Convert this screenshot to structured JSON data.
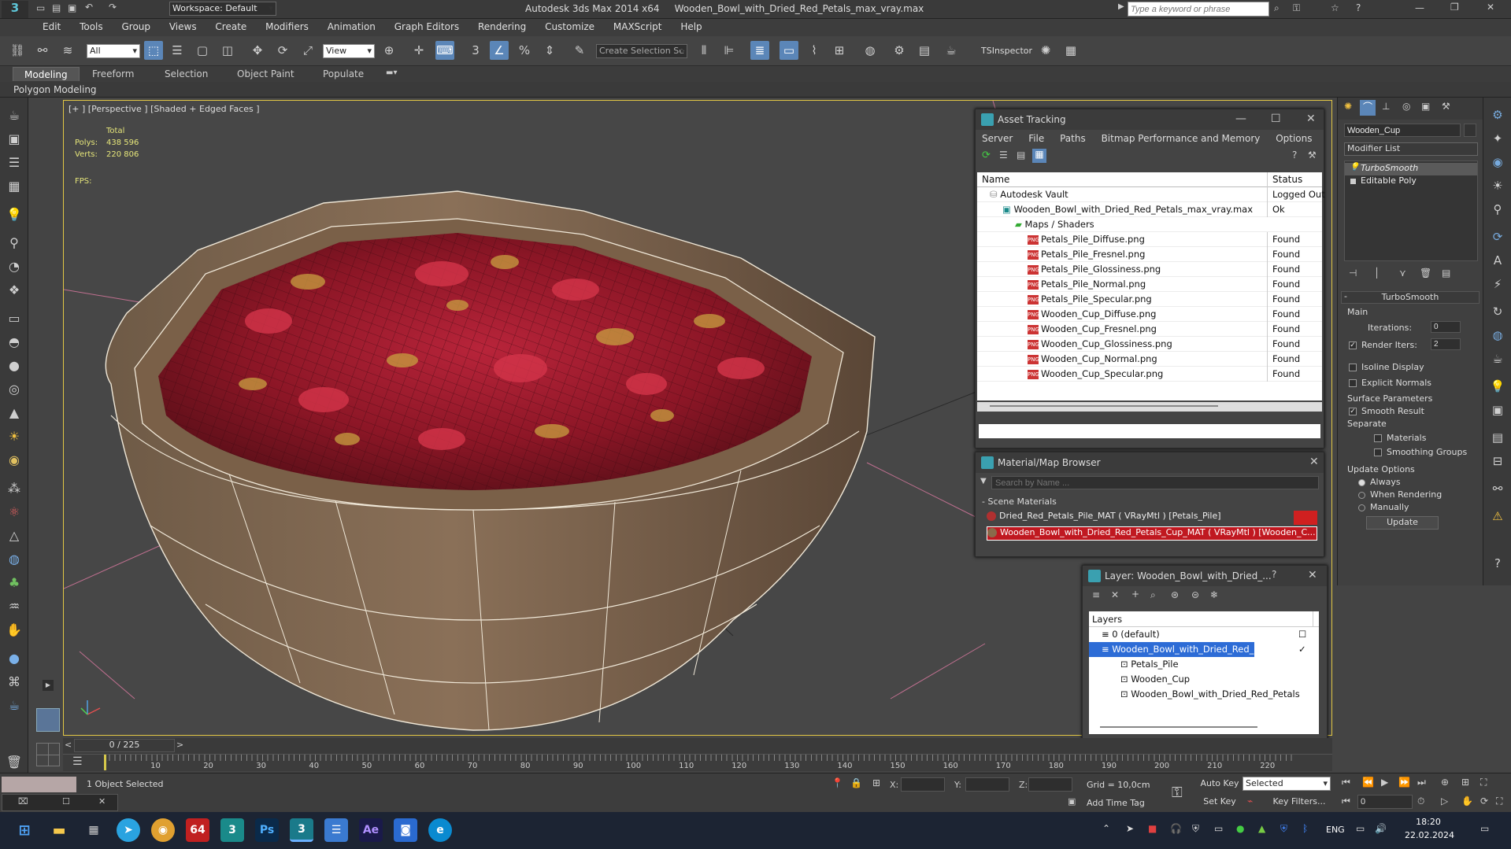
{
  "app": {
    "title": "Autodesk 3ds Max  2014 x64",
    "file": "Wooden_Bowl_with_Dried_Red_Petals_max_vray.max",
    "workspace": "Workspace: Default",
    "search_placeholder": "Type a keyword or phrase"
  },
  "menu": [
    "Edit",
    "Tools",
    "Group",
    "Views",
    "Create",
    "Modifiers",
    "Animation",
    "Graph Editors",
    "Rendering",
    "Customize",
    "MAXScript",
    "Help"
  ],
  "toolbar": {
    "filter": "All",
    "ref_coord": "View",
    "selection_set": "Create Selection Se",
    "inspector": "TSInspector"
  },
  "ribbon": {
    "tabs": [
      "Modeling",
      "Freeform",
      "Selection",
      "Object Paint",
      "Populate"
    ],
    "sub": "Polygon Modeling"
  },
  "viewport": {
    "label": "[+ ] [Perspective ] [Shaded + Edged Faces ]",
    "total_label": "Total",
    "polys_label": "Polys:",
    "polys": "438 596",
    "verts_label": "Verts:",
    "verts": "220 806",
    "fps_label": "FPS:"
  },
  "asset_tracking": {
    "title": "Asset Tracking",
    "menu": [
      "Server",
      "File",
      "Paths",
      "Bitmap Performance and Memory",
      "Options"
    ],
    "col_name": "Name",
    "col_status": "Status",
    "rows": [
      {
        "name": "Autodesk Vault",
        "status": "Logged Out",
        "indent": 1,
        "kind": "vault"
      },
      {
        "name": "Wooden_Bowl_with_Dried_Red_Petals_max_vray.max",
        "status": "Ok",
        "indent": 2,
        "kind": "max"
      },
      {
        "name": "Maps / Shaders",
        "status": "",
        "indent": 3,
        "kind": "folder"
      },
      {
        "name": "Petals_Pile_Diffuse.png",
        "status": "Found",
        "indent": 4,
        "kind": "png"
      },
      {
        "name": "Petals_Pile_Fresnel.png",
        "status": "Found",
        "indent": 4,
        "kind": "png"
      },
      {
        "name": "Petals_Pile_Glossiness.png",
        "status": "Found",
        "indent": 4,
        "kind": "png"
      },
      {
        "name": "Petals_Pile_Normal.png",
        "status": "Found",
        "indent": 4,
        "kind": "png"
      },
      {
        "name": "Petals_Pile_Specular.png",
        "status": "Found",
        "indent": 4,
        "kind": "png"
      },
      {
        "name": "Wooden_Cup_Diffuse.png",
        "status": "Found",
        "indent": 4,
        "kind": "png"
      },
      {
        "name": "Wooden_Cup_Fresnel.png",
        "status": "Found",
        "indent": 4,
        "kind": "png"
      },
      {
        "name": "Wooden_Cup_Glossiness.png",
        "status": "Found",
        "indent": 4,
        "kind": "png"
      },
      {
        "name": "Wooden_Cup_Normal.png",
        "status": "Found",
        "indent": 4,
        "kind": "png"
      },
      {
        "name": "Wooden_Cup_Specular.png",
        "status": "Found",
        "indent": 4,
        "kind": "png"
      }
    ]
  },
  "material_browser": {
    "title": "Material/Map Browser",
    "search_placeholder": "Search by Name ...",
    "section": "- Scene Materials",
    "items": [
      "Dried_Red_Petals_Pile_MAT  ( VRayMtl )  [Petals_Pile]",
      "Wooden_Bowl_with_Dried_Red_Petals_Cup_MAT  ( VRayMtl )  [Wooden_C..."
    ]
  },
  "layer": {
    "title": "Layer: Wooden_Bowl_with_Dried_...",
    "help": "?",
    "header": "Layers",
    "rows": [
      {
        "name": "0 (default)",
        "indent": 0,
        "selected": false
      },
      {
        "name": "Wooden_Bowl_with_Dried_Red_Petals",
        "indent": 0,
        "selected": true
      },
      {
        "name": "Petals_Pile",
        "indent": 1,
        "selected": false
      },
      {
        "name": "Wooden_Cup",
        "indent": 1,
        "selected": false
      },
      {
        "name": "Wooden_Bowl_with_Dried_Red_Petals",
        "indent": 1,
        "selected": false
      }
    ]
  },
  "modify": {
    "object_name": "Wooden_Cup",
    "modifier_list": "Modifier List",
    "stack": [
      "TurboSmooth",
      "Editable Poly"
    ],
    "rollout": "TurboSmooth",
    "main": "Main",
    "iterations_label": "Iterations:",
    "iterations": "0",
    "render_iters_label": "Render Iters:",
    "render_iters": "2",
    "isoline": "Isoline Display",
    "explicit": "Explicit Normals",
    "surface": "Surface Parameters",
    "smooth": "Smooth Result",
    "separate": "Separate",
    "materials": "Materials",
    "smoothing": "Smoothing Groups",
    "update_options": "Update Options",
    "always": "Always",
    "when_rendering": "When Rendering",
    "manually": "Manually",
    "update_btn": "Update"
  },
  "timeline": {
    "frame": "0 / 225",
    "ticks": [
      "10",
      "20",
      "30",
      "40",
      "50",
      "60",
      "70",
      "80",
      "90",
      "100",
      "110",
      "120",
      "130",
      "140",
      "150",
      "160",
      "170",
      "180",
      "190",
      "200",
      "210",
      "220"
    ]
  },
  "status": {
    "selected": "1 Object Selected",
    "x": "X:",
    "y": "Y:",
    "z": "Z:",
    "grid": "Grid = 10,0cm",
    "autokey": "Auto Key",
    "selected_dd": "Selected",
    "setkey": "Set Key",
    "keyfilters": "Key Filters...",
    "addtime": "Add Time Tag",
    "frame_field": "0"
  },
  "taskbar": {
    "lang": "ENG",
    "time": "18:20",
    "date": "22.02.2024"
  },
  "colors": {
    "accent": "#5b86b8",
    "selection": "#2d6cd6",
    "viewport_border": "#e3c845"
  }
}
